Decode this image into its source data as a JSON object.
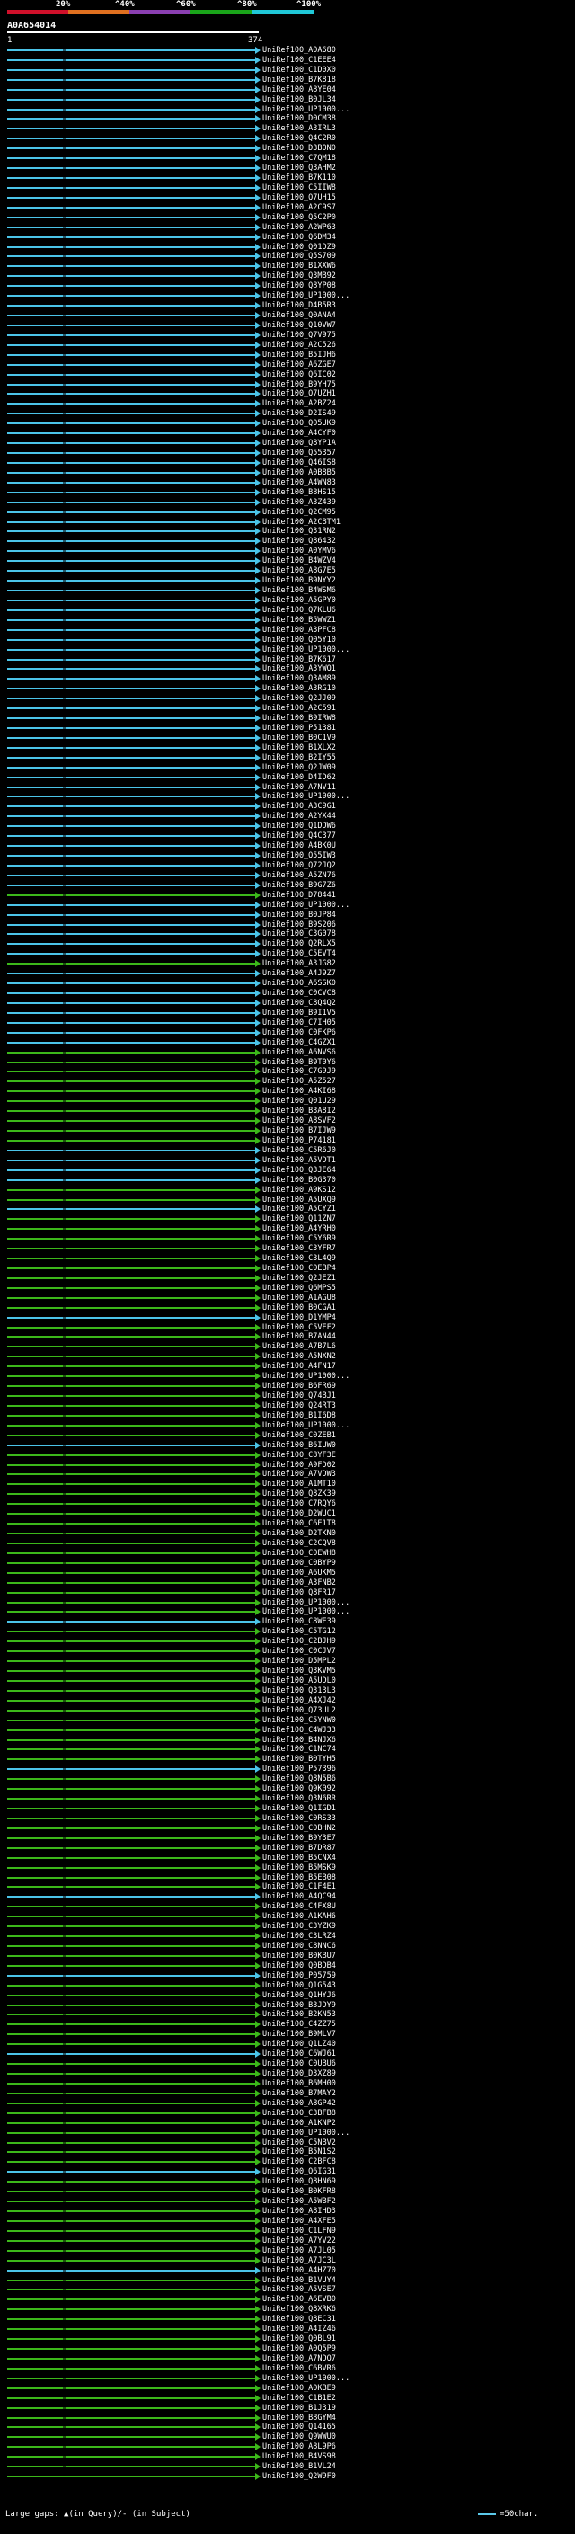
{
  "legend": {
    "labels": [
      "20%",
      "^40%",
      "^60%",
      "^80%",
      "^100%"
    ],
    "colors": [
      "#d0102a",
      "#e07020",
      "#8a3fb0",
      "#1aa51a",
      "#20c8d8"
    ]
  },
  "query": {
    "id": "A0A654014",
    "start": "1",
    "end": "374"
  },
  "footer": {
    "gaps_text": "Large gaps: ▲(in Query)/- (in Subject)",
    "scale_text": "=50char."
  },
  "colors": {
    "cyan": "#4bc4e8",
    "green": "#3cb81a",
    "background": "#000000"
  },
  "hits": [
    {
      "label": "UniRef100_A0A680",
      "color": "cyan"
    },
    {
      "label": "UniRef100_C1EEE4",
      "color": "cyan"
    },
    {
      "label": "UniRef100_C1D0X0",
      "color": "cyan"
    },
    {
      "label": "UniRef100_B7K818",
      "color": "cyan"
    },
    {
      "label": "UniRef100_A8YE04",
      "color": "cyan"
    },
    {
      "label": "UniRef100_B0JL34",
      "color": "cyan"
    },
    {
      "label": "UniRef100_UP1000...",
      "color": "cyan"
    },
    {
      "label": "UniRef100_D0CM38",
      "color": "cyan"
    },
    {
      "label": "UniRef100_A3IRL3",
      "color": "cyan"
    },
    {
      "label": "UniRef100_Q4C2R0",
      "color": "cyan"
    },
    {
      "label": "UniRef100_D3B0N0",
      "color": "cyan"
    },
    {
      "label": "UniRef100_C7QM18",
      "color": "cyan"
    },
    {
      "label": "UniRef100_Q3AHM2",
      "color": "cyan"
    },
    {
      "label": "UniRef100_B7K110",
      "color": "cyan"
    },
    {
      "label": "UniRef100_C5IIW8",
      "color": "cyan"
    },
    {
      "label": "UniRef100_Q7UH15",
      "color": "cyan"
    },
    {
      "label": "UniRef100_A2C9S7",
      "color": "cyan"
    },
    {
      "label": "UniRef100_Q5C2P0",
      "color": "cyan"
    },
    {
      "label": "UniRef100_A2WP63",
      "color": "cyan"
    },
    {
      "label": "UniRef100_Q6DM34",
      "color": "cyan"
    },
    {
      "label": "UniRef100_Q01DZ9",
      "color": "cyan"
    },
    {
      "label": "UniRef100_Q5S709",
      "color": "cyan"
    },
    {
      "label": "UniRef100_B1XXW6",
      "color": "cyan"
    },
    {
      "label": "UniRef100_Q3MB92",
      "color": "cyan"
    },
    {
      "label": "UniRef100_Q8YP08",
      "color": "cyan"
    },
    {
      "label": "UniRef100_UP1000...",
      "color": "cyan"
    },
    {
      "label": "UniRef100_D4B5R3",
      "color": "cyan"
    },
    {
      "label": "UniRef100_Q0ANA4",
      "color": "cyan"
    },
    {
      "label": "UniRef100_Q10VW7",
      "color": "cyan"
    },
    {
      "label": "UniRef100_Q7V975",
      "color": "cyan"
    },
    {
      "label": "UniRef100_A2C526",
      "color": "cyan"
    },
    {
      "label": "UniRef100_B5IJH6",
      "color": "cyan"
    },
    {
      "label": "UniRef100_A6ZGE7",
      "color": "cyan"
    },
    {
      "label": "UniRef100_Q6IC02",
      "color": "cyan"
    },
    {
      "label": "UniRef100_B9YH75",
      "color": "cyan"
    },
    {
      "label": "UniRef100_Q7UZH1",
      "color": "cyan"
    },
    {
      "label": "UniRef100_A2BZ24",
      "color": "cyan"
    },
    {
      "label": "UniRef100_D2IS49",
      "color": "cyan"
    },
    {
      "label": "UniRef100_Q05UK9",
      "color": "cyan"
    },
    {
      "label": "UniRef100_A4CYF0",
      "color": "cyan"
    },
    {
      "label": "UniRef100_Q8YP1A",
      "color": "cyan"
    },
    {
      "label": "UniRef100_Q55357",
      "color": "cyan"
    },
    {
      "label": "UniRef100_Q46IS8",
      "color": "cyan"
    },
    {
      "label": "UniRef100_A0B8B5",
      "color": "cyan"
    },
    {
      "label": "UniRef100_A4WN83",
      "color": "cyan"
    },
    {
      "label": "UniRef100_B8HS15",
      "color": "cyan"
    },
    {
      "label": "UniRef100_A3Z439",
      "color": "cyan"
    },
    {
      "label": "UniRef100_Q2CM95",
      "color": "cyan"
    },
    {
      "label": "UniRef100_A2CBTM1",
      "color": "cyan"
    },
    {
      "label": "UniRef100_Q31RN2",
      "color": "cyan"
    },
    {
      "label": "UniRef100_Q86432",
      "color": "cyan"
    },
    {
      "label": "UniRef100_A0YMV6",
      "color": "cyan"
    },
    {
      "label": "UniRef100_B4WZV4",
      "color": "cyan"
    },
    {
      "label": "UniRef100_A8G7E5",
      "color": "cyan"
    },
    {
      "label": "UniRef100_B9NYY2",
      "color": "cyan"
    },
    {
      "label": "UniRef100_B4WSM6",
      "color": "cyan"
    },
    {
      "label": "UniRef100_A5GPY0",
      "color": "cyan"
    },
    {
      "label": "UniRef100_Q7KLU6",
      "color": "cyan"
    },
    {
      "label": "UniRef100_B5WWZ1",
      "color": "cyan"
    },
    {
      "label": "UniRef100_A3PFC8",
      "color": "cyan"
    },
    {
      "label": "UniRef100_Q05Y10",
      "color": "cyan"
    },
    {
      "label": "UniRef100_UP1000...",
      "color": "cyan"
    },
    {
      "label": "UniRef100_B7K617",
      "color": "cyan"
    },
    {
      "label": "UniRef100_A3YWQ1",
      "color": "cyan"
    },
    {
      "label": "UniRef100_Q3AM89",
      "color": "cyan"
    },
    {
      "label": "UniRef100_A3RG10",
      "color": "cyan"
    },
    {
      "label": "UniRef100_Q2JJ09",
      "color": "cyan"
    },
    {
      "label": "UniRef100_A2C591",
      "color": "cyan"
    },
    {
      "label": "UniRef100_B9IRW8",
      "color": "cyan"
    },
    {
      "label": "UniRef100_P51381",
      "color": "cyan"
    },
    {
      "label": "UniRef100_B0C1V9",
      "color": "cyan"
    },
    {
      "label": "UniRef100_B1XLX2",
      "color": "cyan"
    },
    {
      "label": "UniRef100_B2IY55",
      "color": "cyan"
    },
    {
      "label": "UniRef100_Q2JW09",
      "color": "cyan"
    },
    {
      "label": "UniRef100_D4ID62",
      "color": "cyan"
    },
    {
      "label": "UniRef100_A7NV11",
      "color": "cyan"
    },
    {
      "label": "UniRef100_UP1000...",
      "color": "cyan"
    },
    {
      "label": "UniRef100_A3C9G1",
      "color": "cyan"
    },
    {
      "label": "UniRef100_A2YX44",
      "color": "cyan"
    },
    {
      "label": "UniRef100_Q1DDW6",
      "color": "cyan"
    },
    {
      "label": "UniRef100_Q4C377",
      "color": "cyan"
    },
    {
      "label": "UniRef100_A4BK0U",
      "color": "cyan"
    },
    {
      "label": "UniRef100_Q55IW3",
      "color": "cyan"
    },
    {
      "label": "UniRef100_Q72JQ2",
      "color": "cyan"
    },
    {
      "label": "UniRef100_A5ZN76",
      "color": "cyan"
    },
    {
      "label": "UniRef100_B9G7Z6",
      "color": "cyan"
    },
    {
      "label": "UniRef100_D78441",
      "color": "green"
    },
    {
      "label": "UniRef100_UP1000...",
      "color": "cyan"
    },
    {
      "label": "UniRef100_B0JP84",
      "color": "cyan"
    },
    {
      "label": "UniRef100_B9S206",
      "color": "cyan"
    },
    {
      "label": "UniRef100_C3G078",
      "color": "cyan"
    },
    {
      "label": "UniRef100_Q2RLX5",
      "color": "cyan"
    },
    {
      "label": "UniRef100_C5EVT4",
      "color": "cyan"
    },
    {
      "label": "UniRef100_A3JG82",
      "color": "green"
    },
    {
      "label": "UniRef100_A4J9Z7",
      "color": "cyan"
    },
    {
      "label": "UniRef100_A6SSK0",
      "color": "cyan"
    },
    {
      "label": "UniRef100_C0CVC8",
      "color": "cyan"
    },
    {
      "label": "UniRef100_C8Q4Q2",
      "color": "cyan"
    },
    {
      "label": "UniRef100_B9I1V5",
      "color": "cyan"
    },
    {
      "label": "UniRef100_C7IH05",
      "color": "cyan"
    },
    {
      "label": "UniRef100_C0FKP6",
      "color": "cyan"
    },
    {
      "label": "UniRef100_C4GZX1",
      "color": "cyan"
    },
    {
      "label": "UniRef100_A6NVS6",
      "color": "green"
    },
    {
      "label": "UniRef100_B9T0Y6",
      "color": "green"
    },
    {
      "label": "UniRef100_C7G9J9",
      "color": "green"
    },
    {
      "label": "UniRef100_A5Z527",
      "color": "green"
    },
    {
      "label": "UniRef100_A4KI68",
      "color": "green"
    },
    {
      "label": "UniRef100_Q01U29",
      "color": "green"
    },
    {
      "label": "UniRef100_B3A8I2",
      "color": "green"
    },
    {
      "label": "UniRef100_A8SVF2",
      "color": "green"
    },
    {
      "label": "UniRef100_B7IJW9",
      "color": "green"
    },
    {
      "label": "UniRef100_P74181",
      "color": "green"
    },
    {
      "label": "UniRef100_C5R6J0",
      "color": "cyan"
    },
    {
      "label": "UniRef100_A5VDT1",
      "color": "cyan"
    },
    {
      "label": "UniRef100_Q3JE64",
      "color": "cyan"
    },
    {
      "label": "UniRef100_B0G370",
      "color": "cyan"
    },
    {
      "label": "UniRef100_A9KS12",
      "color": "green"
    },
    {
      "label": "UniRef100_A5UXQ9",
      "color": "green"
    },
    {
      "label": "UniRef100_A5CYZ1",
      "color": "cyan"
    },
    {
      "label": "UniRef100_Q11ZN7",
      "color": "green"
    },
    {
      "label": "UniRef100_A4YRH0",
      "color": "green"
    },
    {
      "label": "UniRef100_C5Y6R9",
      "color": "green"
    },
    {
      "label": "UniRef100_C3YFR7",
      "color": "green"
    },
    {
      "label": "UniRef100_C3L4Q9",
      "color": "green"
    },
    {
      "label": "UniRef100_C0EBP4",
      "color": "green"
    },
    {
      "label": "UniRef100_Q2JEZ1",
      "color": "green"
    },
    {
      "label": "UniRef100_Q6MPS5",
      "color": "green"
    },
    {
      "label": "UniRef100_A1AGU8",
      "color": "green"
    },
    {
      "label": "UniRef100_B0CGA1",
      "color": "green"
    },
    {
      "label": "UniRef100_D1YMP4",
      "color": "cyan"
    },
    {
      "label": "UniRef100_C5VEF2",
      "color": "green"
    },
    {
      "label": "UniRef100_B7AN44",
      "color": "green"
    },
    {
      "label": "UniRef100_A7B7L6",
      "color": "green"
    },
    {
      "label": "UniRef100_A5NXN2",
      "color": "green"
    },
    {
      "label": "UniRef100_A4FN17",
      "color": "green"
    },
    {
      "label": "UniRef100_UP1000...",
      "color": "green"
    },
    {
      "label": "UniRef100_B6FR69",
      "color": "green"
    },
    {
      "label": "UniRef100_Q74BJ1",
      "color": "green"
    },
    {
      "label": "UniRef100_Q24RT3",
      "color": "green"
    },
    {
      "label": "UniRef100_B1I6D8",
      "color": "green"
    },
    {
      "label": "UniRef100_UP1000...",
      "color": "green"
    },
    {
      "label": "UniRef100_C0ZEB1",
      "color": "green"
    },
    {
      "label": "UniRef100_B6IUW0",
      "color": "cyan"
    },
    {
      "label": "UniRef100_C8YF3E",
      "color": "green"
    },
    {
      "label": "UniRef100_A9FD02",
      "color": "green"
    },
    {
      "label": "UniRef100_A7VDW3",
      "color": "green"
    },
    {
      "label": "UniRef100_A1MT10",
      "color": "green"
    },
    {
      "label": "UniRef100_Q8ZK39",
      "color": "green"
    },
    {
      "label": "UniRef100_C7RQY6",
      "color": "green"
    },
    {
      "label": "UniRef100_D2WUC1",
      "color": "green"
    },
    {
      "label": "UniRef100_C6E1T8",
      "color": "green"
    },
    {
      "label": "UniRef100_D2TKN0",
      "color": "green"
    },
    {
      "label": "UniRef100_C2CQV8",
      "color": "green"
    },
    {
      "label": "UniRef100_C0EWH8",
      "color": "green"
    },
    {
      "label": "UniRef100_C0BYP9",
      "color": "green"
    },
    {
      "label": "UniRef100_A6UKM5",
      "color": "green"
    },
    {
      "label": "UniRef100_A3FNB2",
      "color": "green"
    },
    {
      "label": "UniRef100_Q8FR17",
      "color": "green"
    },
    {
      "label": "UniRef100_UP1000...",
      "color": "green"
    },
    {
      "label": "UniRef100_UP1000...",
      "color": "green"
    },
    {
      "label": "UniRef100_C8WE39",
      "color": "cyan"
    },
    {
      "label": "UniRef100_C5TG12",
      "color": "green"
    },
    {
      "label": "UniRef100_C2BJH9",
      "color": "green"
    },
    {
      "label": "UniRef100_C0CJV7",
      "color": "green"
    },
    {
      "label": "UniRef100_D5MPL2",
      "color": "green"
    },
    {
      "label": "UniRef100_Q3KVM5",
      "color": "green"
    },
    {
      "label": "UniRef100_A5UDL0",
      "color": "green"
    },
    {
      "label": "UniRef100_Q313L3",
      "color": "green"
    },
    {
      "label": "UniRef100_A4XJ42",
      "color": "green"
    },
    {
      "label": "UniRef100_Q73UL2",
      "color": "green"
    },
    {
      "label": "UniRef100_C5YNW0",
      "color": "green"
    },
    {
      "label": "UniRef100_C4WJ33",
      "color": "green"
    },
    {
      "label": "UniRef100_B4NJX6",
      "color": "green"
    },
    {
      "label": "UniRef100_C1NC74",
      "color": "green"
    },
    {
      "label": "UniRef100_B0TYH5",
      "color": "green"
    },
    {
      "label": "UniRef100_P57396",
      "color": "cyan"
    },
    {
      "label": "UniRef100_Q8N5B6",
      "color": "green"
    },
    {
      "label": "UniRef100_Q9K092",
      "color": "green"
    },
    {
      "label": "UniRef100_Q3N6RR",
      "color": "green"
    },
    {
      "label": "UniRef100_Q1IGD1",
      "color": "green"
    },
    {
      "label": "UniRef100_C0RS33",
      "color": "green"
    },
    {
      "label": "UniRef100_C0BHN2",
      "color": "green"
    },
    {
      "label": "UniRef100_B9Y3E7",
      "color": "green"
    },
    {
      "label": "UniRef100_B7DR87",
      "color": "green"
    },
    {
      "label": "UniRef100_B5CNX4",
      "color": "green"
    },
    {
      "label": "UniRef100_B5MSK9",
      "color": "green"
    },
    {
      "label": "UniRef100_B5EB08",
      "color": "green"
    },
    {
      "label": "UniRef100_C1F4E1",
      "color": "green"
    },
    {
      "label": "UniRef100_A4QC94",
      "color": "cyan"
    },
    {
      "label": "UniRef100_C4FX8U",
      "color": "green"
    },
    {
      "label": "UniRef100_A1KAH6",
      "color": "green"
    },
    {
      "label": "UniRef100_C3YZK9",
      "color": "green"
    },
    {
      "label": "UniRef100_C3LRZ4",
      "color": "green"
    },
    {
      "label": "UniRef100_C8NNC6",
      "color": "green"
    },
    {
      "label": "UniRef100_B0KBU7",
      "color": "green"
    },
    {
      "label": "UniRef100_Q0BDB4",
      "color": "green"
    },
    {
      "label": "UniRef100_P05759",
      "color": "cyan"
    },
    {
      "label": "UniRef100_Q1G543",
      "color": "green"
    },
    {
      "label": "UniRef100_Q1HYJ6",
      "color": "green"
    },
    {
      "label": "UniRef100_B3JDY9",
      "color": "green"
    },
    {
      "label": "UniRef100_B2KN53",
      "color": "green"
    },
    {
      "label": "UniRef100_C4ZZ75",
      "color": "green"
    },
    {
      "label": "UniRef100_B9MLV7",
      "color": "green"
    },
    {
      "label": "UniRef100_Q1LZ40",
      "color": "green"
    },
    {
      "label": "UniRef100_C6WJ61",
      "color": "cyan"
    },
    {
      "label": "UniRef100_C0UBU6",
      "color": "green"
    },
    {
      "label": "UniRef100_D3XZ89",
      "color": "green"
    },
    {
      "label": "UniRef100_B6MH00",
      "color": "green"
    },
    {
      "label": "UniRef100_B7MAY2",
      "color": "green"
    },
    {
      "label": "UniRef100_A8GP42",
      "green": "",
      "color": "green"
    },
    {
      "label": "UniRef100_C3BFB8",
      "color": "green"
    },
    {
      "label": "UniRef100_A1KNP2",
      "color": "green"
    },
    {
      "label": "UniRef100_UP1000...",
      "color": "green"
    },
    {
      "label": "UniRef100_C5NBV2",
      "color": "green"
    },
    {
      "label": "UniRef100_B5N1S2",
      "color": "green"
    },
    {
      "label": "UniRef100_C2BFC8",
      "color": "green"
    },
    {
      "label": "UniRef100_Q6IG31",
      "color": "cyan"
    },
    {
      "label": "UniRef100_Q8HN69",
      "color": "green"
    },
    {
      "label": "UniRef100_B0KFR8",
      "color": "green"
    },
    {
      "label": "UniRef100_A5WBF2",
      "color": "green"
    },
    {
      "label": "UniRef100_A8IHD3",
      "color": "green"
    },
    {
      "label": "UniRef100_A4XFE5",
      "color": "green"
    },
    {
      "label": "UniRef100_C1LFN9",
      "color": "green"
    },
    {
      "label": "UniRef100_A7YV22",
      "color": "green"
    },
    {
      "label": "UniRef100_A7JL05",
      "color": "green"
    },
    {
      "label": "UniRef100_A7JC3L",
      "color": "green"
    },
    {
      "label": "UniRef100_A4HZ70",
      "color": "cyan"
    },
    {
      "label": "UniRef100_B1VUY4",
      "color": "green"
    },
    {
      "label": "UniRef100_A5VSE7",
      "color": "green"
    },
    {
      "label": "UniRef100_A6EVB0",
      "color": "green"
    },
    {
      "label": "UniRef100_Q8XRK6",
      "color": "green"
    },
    {
      "label": "UniRef100_Q8EC31",
      "color": "green"
    },
    {
      "label": "UniRef100_A4IZ46",
      "color": "green"
    },
    {
      "label": "UniRef100_Q0BL91",
      "color": "green"
    },
    {
      "label": "UniRef100_A0Q5P9",
      "color": "green"
    },
    {
      "label": "UniRef100_A7NDQ7",
      "color": "green"
    },
    {
      "label": "UniRef100_C6BVR6",
      "color": "green"
    },
    {
      "label": "UniRef100_UP1000...",
      "color": "green"
    },
    {
      "label": "UniRef100_A0KBE9",
      "color": "green"
    },
    {
      "label": "UniRef100_C1B1E2",
      "color": "green"
    },
    {
      "label": "UniRef100_B1J319",
      "color": "green"
    },
    {
      "label": "UniRef100_B8GYM4",
      "color": "green"
    },
    {
      "label": "UniRef100_Q14165",
      "color": "green"
    },
    {
      "label": "UniRef100_Q9WWU0",
      "color": "green"
    },
    {
      "label": "UniRef100_A8L9P6",
      "color": "green"
    },
    {
      "label": "UniRef100_B4VS98",
      "color": "green"
    },
    {
      "label": "UniRef100_B1VL24",
      "color": "green"
    },
    {
      "label": "UniRef100_Q2W9F0",
      "color": "green"
    }
  ]
}
